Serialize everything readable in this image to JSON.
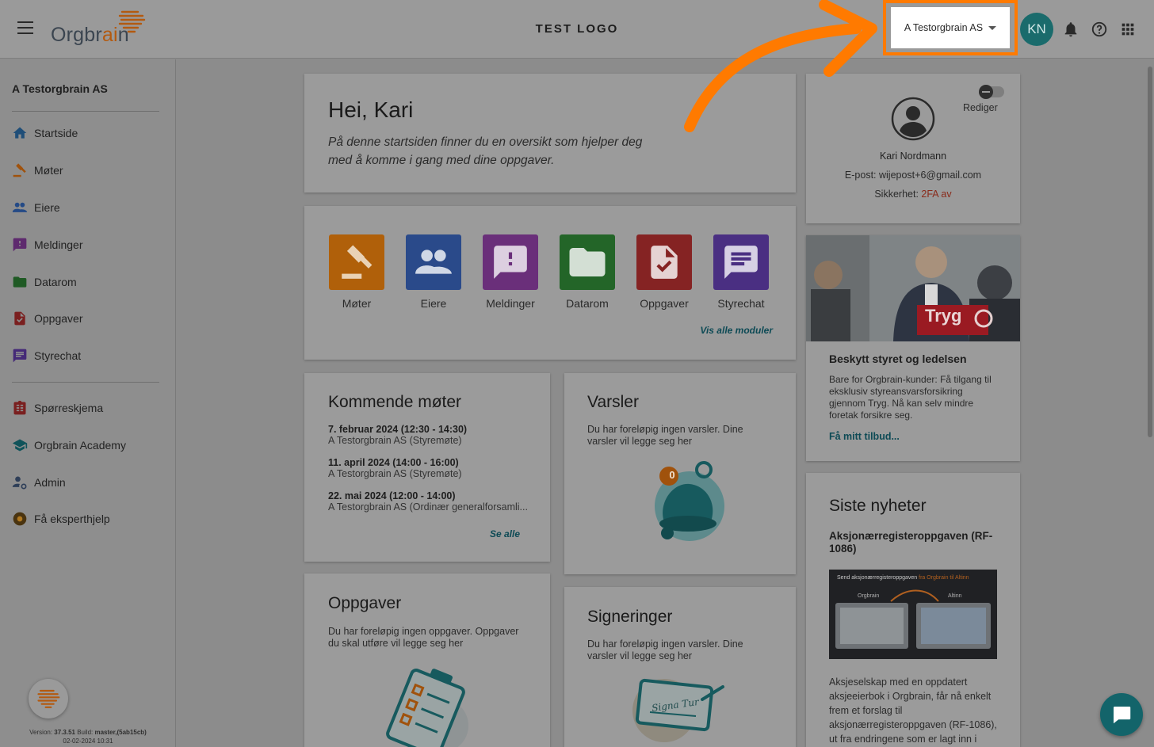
{
  "header": {
    "brand": {
      "text_before": "Orgbr",
      "text_accent": "ai",
      "text_after": "n"
    },
    "center_logo": "TEST LOGO",
    "org_selector": "A Testorgbrain AS",
    "avatar_initials": "KN",
    "icons": [
      "menu-icon",
      "bell-icon",
      "help-icon",
      "apps-grid-icon"
    ]
  },
  "sidebar": {
    "org_name": "A Testorgbrain AS",
    "items": [
      {
        "label": "Startside",
        "icon": "home-icon"
      },
      {
        "label": "Møter",
        "icon": "gavel-icon"
      },
      {
        "label": "Eiere",
        "icon": "people-icon"
      },
      {
        "label": "Meldinger",
        "icon": "message-alert-icon"
      },
      {
        "label": "Datarom",
        "icon": "folder-icon"
      },
      {
        "label": "Oppgaver",
        "icon": "task-doc-icon"
      },
      {
        "label": "Styrechat",
        "icon": "chat-icon"
      },
      {
        "label": "Spørreskjema",
        "icon": "survey-icon"
      },
      {
        "label": "Orgbrain Academy",
        "icon": "academy-icon"
      },
      {
        "label": "Admin",
        "icon": "admin-icon"
      },
      {
        "label": "Få eksperthjelp",
        "icon": "expert-icon"
      }
    ],
    "version_line1_prefix": "Version: ",
    "version": "37.3.51",
    "build_prefix": " Build: ",
    "build": "master,(5ab15cb)",
    "date": "02-02-2024 10:31"
  },
  "welcome": {
    "title": "Hei, Kari",
    "text_line1": "På denne startsiden finner du en oversikt som hjelper deg",
    "text_line2": "med å komme i gang med dine oppgaver."
  },
  "modules": {
    "items": [
      {
        "label": "Møter",
        "color": "#b0600a"
      },
      {
        "label": "Eiere",
        "color": "#2a4a8a"
      },
      {
        "label": "Meldinger",
        "color": "#6a2f7a"
      },
      {
        "label": "Datarom",
        "color": "#236528"
      },
      {
        "label": "Oppgaver",
        "color": "#852323"
      },
      {
        "label": "Styrechat",
        "color": "#4a2f82"
      }
    ],
    "show_all": "Vis alle moduler"
  },
  "meetings": {
    "title": "Kommende møter",
    "items": [
      {
        "date": "7. februar 2024 (12:30 - 14:30)",
        "desc": "A Testorgbrain AS (Styremøte)"
      },
      {
        "date": "11. april 2024 (14:00 - 16:00)",
        "desc": "A Testorgbrain AS (Styremøte)"
      },
      {
        "date": "22. mai 2024 (12:00 - 14:00)",
        "desc": "A Testorgbrain AS (Ordinær generalforsamli..."
      }
    ],
    "see_all": "Se alle"
  },
  "alerts": {
    "title": "Varsler",
    "line1": "Du har foreløpig ingen varsler. Dine",
    "line2": "varsler vil legge seg her",
    "badge": "0"
  },
  "tasks": {
    "title": "Oppgaver",
    "line1": "Du har foreløpig ingen oppgaver. Oppgaver",
    "line2": "du skal utføre vil legge seg her"
  },
  "signatures": {
    "title": "Signeringer",
    "line1": "Du har foreløpig ingen varsler. Dine",
    "line2": "varsler vil legge seg her",
    "signature_text": "Signa Tur"
  },
  "profile": {
    "edit_label": "Rediger",
    "name": "Kari Nordmann",
    "email_label": "E-post: ",
    "email": "wijepost+6@gmail.com",
    "security_label": "Sikkerhet: ",
    "security_value": "2FA av",
    "security_color": "#8a2a1a"
  },
  "promo": {
    "brand": "Tryg",
    "title": "Beskytt styret og ledelsen",
    "text_line1": "Bare for Orgbrain-kunder: Få tilgang til",
    "text_line2": "eksklusiv styreansvarsforsikring",
    "text_line3": "gjennom Tryg. Nå kan selv mindre",
    "text_line4": "foretak forsikre seg.",
    "cta": "Få mitt tilbud..."
  },
  "news": {
    "title": "Siste nyheter",
    "headline_line1": "Aksjonærregisteroppgaven (RF-",
    "headline_line2": "1086)",
    "image_caption_prefix": "Send aksjonærregisteroppgaven ",
    "image_caption_accent": "fra Orgbrain til Altinn",
    "image_left_label": "Orgbrain",
    "image_right_label": "Altinn",
    "body_line1": "Aksjeselskap med en oppdatert",
    "body_line2": "aksjeeierbok i Orgbrain, får nå enkelt",
    "body_line3": "frem et forslag til",
    "body_line4": "aksjonærregisteroppgaven (RF-1086),",
    "body_line5": "ut fra endringene som er lagt inn i"
  },
  "colors": {
    "highlight": "#ff7a00",
    "accent_teal": "#1a6b6c",
    "overlay_background": "#8c8c8c"
  }
}
